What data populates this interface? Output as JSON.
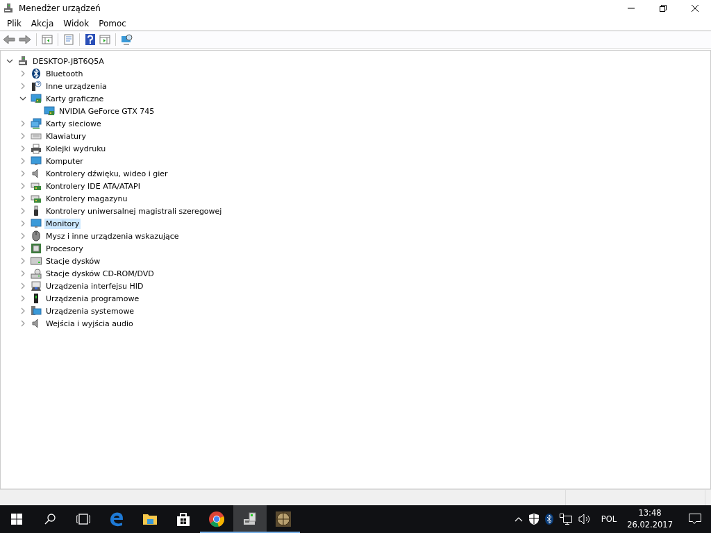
{
  "window": {
    "title": "Menedżer urządzeń"
  },
  "menu": [
    "Plik",
    "Akcja",
    "Widok",
    "Pomoc"
  ],
  "tree": [
    {
      "label": "DESKTOP-JBT6Q5A",
      "expanded": true,
      "selected": false,
      "children": [
        {
          "label": "Bluetooth",
          "expanded": false,
          "selected": false
        },
        {
          "label": "Inne urządzenia",
          "expanded": false,
          "selected": false
        },
        {
          "label": "Karty graficzne",
          "expanded": true,
          "selected": false,
          "children": [
            {
              "label": "NVIDIA GeForce GTX 745",
              "selected": false
            }
          ]
        },
        {
          "label": "Karty sieciowe",
          "expanded": false,
          "selected": false
        },
        {
          "label": "Klawiatury",
          "expanded": false,
          "selected": false
        },
        {
          "label": "Kolejki wydruku",
          "expanded": false,
          "selected": false
        },
        {
          "label": "Komputer",
          "expanded": false,
          "selected": false
        },
        {
          "label": "Kontrolery dźwięku, wideo i gier",
          "expanded": false,
          "selected": false
        },
        {
          "label": "Kontrolery IDE ATA/ATAPI",
          "expanded": false,
          "selected": false
        },
        {
          "label": "Kontrolery magazynu",
          "expanded": false,
          "selected": false
        },
        {
          "label": "Kontrolery uniwersalnej magistrali szeregowej",
          "expanded": false,
          "selected": false
        },
        {
          "label": "Monitory",
          "expanded": false,
          "selected": true
        },
        {
          "label": "Mysz i inne urządzenia wskazujące",
          "expanded": false,
          "selected": false
        },
        {
          "label": "Procesory",
          "expanded": false,
          "selected": false
        },
        {
          "label": "Stacje dysków",
          "expanded": false,
          "selected": false
        },
        {
          "label": "Stacje dysków CD-ROM/DVD",
          "expanded": false,
          "selected": false
        },
        {
          "label": "Urządzenia interfejsu HID",
          "expanded": false,
          "selected": false
        },
        {
          "label": "Urządzenia programowe",
          "expanded": false,
          "selected": false
        },
        {
          "label": "Urządzenia systemowe",
          "expanded": false,
          "selected": false
        },
        {
          "label": "Wejścia i wyjścia audio",
          "expanded": false,
          "selected": false
        }
      ]
    }
  ],
  "taskbar": {
    "apps": [
      {
        "running": false,
        "selected": false
      },
      {
        "running": false,
        "selected": false
      },
      {
        "running": false,
        "selected": false
      },
      {
        "running": true,
        "selected": false
      },
      {
        "running": true,
        "selected": true
      },
      {
        "running": true,
        "selected": false
      }
    ],
    "language": "POL",
    "time": "13:48",
    "date": "26.02.2017"
  }
}
